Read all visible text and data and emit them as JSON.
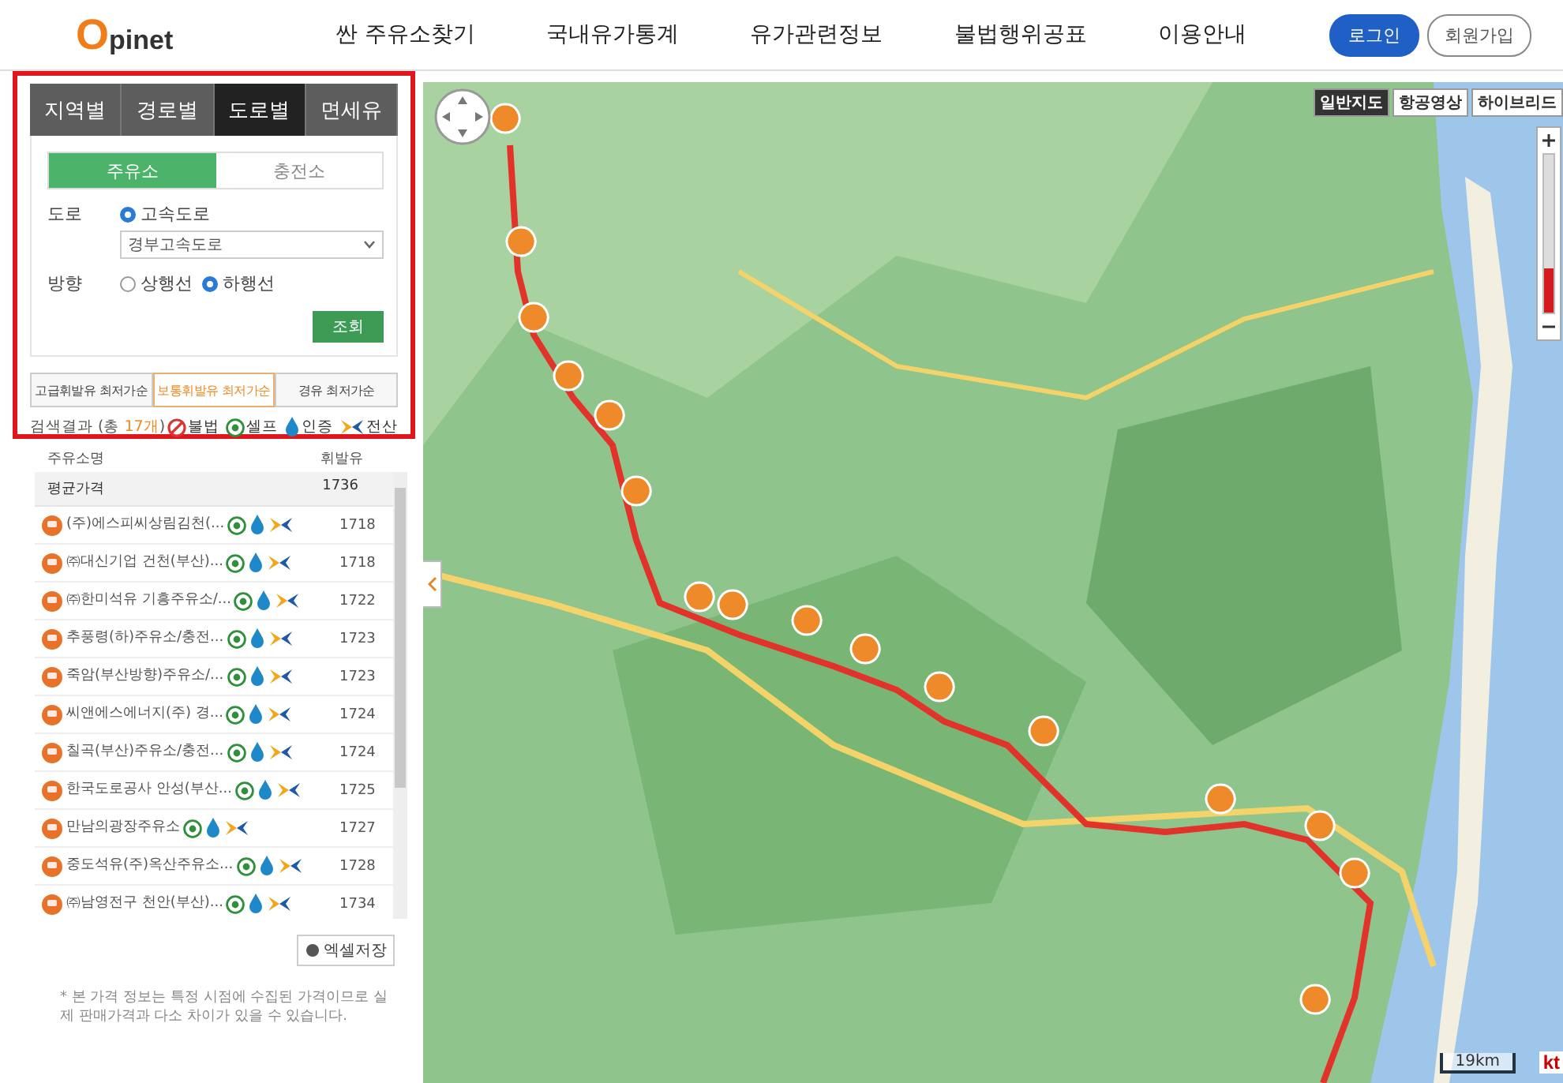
{
  "header": {
    "logo": "Opinet",
    "nav": [
      "싼 주유소찾기",
      "국내유가통계",
      "유가관련정보",
      "불법행위공표",
      "이용안내"
    ],
    "login": "로그인",
    "signup": "회원가입"
  },
  "search_panel": {
    "tabs": [
      {
        "label": "지역별",
        "selected": false
      },
      {
        "label": "경로별",
        "selected": false
      },
      {
        "label": "도로별",
        "selected": true
      },
      {
        "label": "면세유",
        "selected": false
      }
    ],
    "station_tabs": [
      {
        "label": "주유소",
        "selected": true
      },
      {
        "label": "충전소",
        "selected": false
      }
    ],
    "road": {
      "label": "도로",
      "options": [
        {
          "label": "고속도로",
          "selected": true
        }
      ],
      "value": "경부고속도로"
    },
    "direction": {
      "label": "방향",
      "options": [
        {
          "label": "상행선",
          "selected": false
        },
        {
          "label": "하행선",
          "selected": true
        }
      ]
    },
    "search_button": "조회",
    "fuel_tabs": [
      {
        "label": "고급휘발유 최저가순",
        "selected": false
      },
      {
        "label": "보통휘발유 최저가순",
        "selected": true
      },
      {
        "label": "경유 최저가순",
        "selected": false
      }
    ],
    "result": {
      "label": "검색결과 (총 ",
      "count": "17개",
      "end": ")"
    },
    "legend": [
      {
        "kind": "illegal",
        "label": "불법"
      },
      {
        "kind": "self",
        "label": "셀프"
      },
      {
        "kind": "certified",
        "label": "인증"
      },
      {
        "kind": "card",
        "label": "전산"
      }
    ]
  },
  "station_list": {
    "columns": [
      "주유소명",
      "휘발유"
    ],
    "average": {
      "name": "평균가격",
      "price": "1736"
    },
    "rows": [
      {
        "name": "(주)에스피씨상림김천(...",
        "price": "1718",
        "self": true,
        "certified": true,
        "card": true
      },
      {
        "name": "㈜대신기업 건천(부산)...",
        "price": "1718",
        "self": true,
        "certified": true,
        "card": true
      },
      {
        "name": "㈜한미석유 기흥주유소/...",
        "price": "1722",
        "self": true,
        "certified": true,
        "card": true
      },
      {
        "name": "추풍령(하)주유소/충전...",
        "price": "1723",
        "self": true,
        "certified": true,
        "card": true
      },
      {
        "name": "죽암(부산방향)주유소/...",
        "price": "1723",
        "self": true,
        "certified": true,
        "card": true
      },
      {
        "name": "씨앤에스에너지(주) 경...",
        "price": "1724",
        "self": true,
        "certified": true,
        "card": true
      },
      {
        "name": "칠곡(부산)주유소/충전...",
        "price": "1724",
        "self": true,
        "certified": true,
        "card": true
      },
      {
        "name": "한국도로공사 안성(부산...",
        "price": "1725",
        "self": true,
        "certified": true,
        "card": true
      },
      {
        "name": "만남의광장주유소",
        "price": "1727",
        "self": true,
        "certified": true,
        "card": true
      },
      {
        "name": "중도석유(주)옥산주유소...",
        "price": "1728",
        "self": true,
        "certified": true,
        "card": true
      },
      {
        "name": "㈜남영전구 천안(부산)...",
        "price": "1734",
        "self": true,
        "certified": true,
        "card": true
      }
    ],
    "excel_button": "엑셀저장",
    "note": "* 본 가격 정보는 특정 시점에 수집된 가격이므로 실제 판매가격과 다소 차이가 있을 수 있습니다."
  },
  "map": {
    "kind": "picture",
    "map_types": [
      {
        "label": "일반지도",
        "selected": true
      },
      {
        "label": "항공영상",
        "selected": false
      },
      {
        "label": "하이브리드",
        "selected": false
      }
    ],
    "zoom": {
      "level": 0.28
    },
    "scale": "19km",
    "provider": "kt"
  }
}
